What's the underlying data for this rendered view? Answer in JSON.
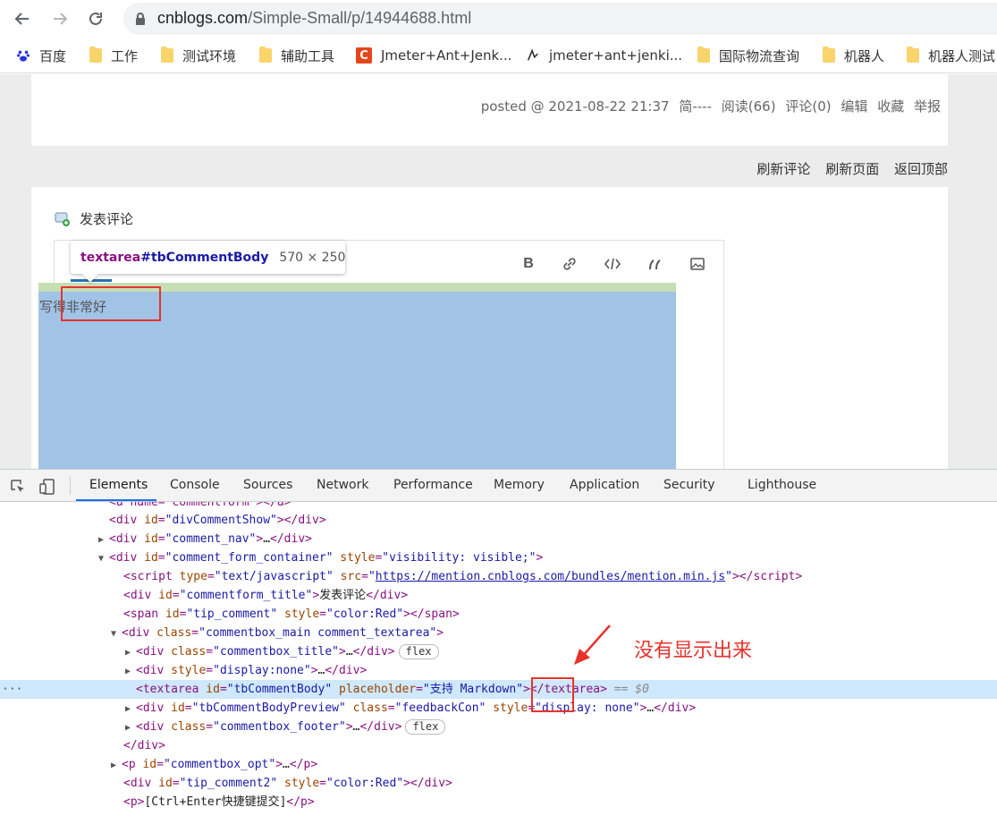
{
  "browser": {
    "url_prefix": "cnblogs.com",
    "url_path": "/Simple-Small/p/14944688.html",
    "bookmarks": [
      {
        "label": "百度",
        "icon": "baidu-paw-icon"
      },
      {
        "label": "工作",
        "icon": "folder-icon"
      },
      {
        "label": "测试环境",
        "icon": "folder-icon"
      },
      {
        "label": "辅助工具",
        "icon": "folder-icon"
      },
      {
        "label": "Jmeter+Ant+Jenk...",
        "icon": "csdn-icon"
      },
      {
        "label": "jmeter+ant+jenki...",
        "icon": "site-icon"
      },
      {
        "label": "国际物流查询",
        "icon": "folder-icon"
      },
      {
        "label": "机器人",
        "icon": "folder-icon"
      },
      {
        "label": "机器人测试",
        "icon": "folder-icon"
      }
    ]
  },
  "post": {
    "posted": "posted @ 2021-08-22 21:37",
    "author": "简----",
    "reads": "阅读(66)",
    "comments": "评论(0)",
    "edit": "编辑",
    "favorite": "收藏",
    "report": "举报"
  },
  "links": {
    "refresh_comments": "刷新评论",
    "refresh_page": "刷新页面",
    "back_to_top": "返回顶部"
  },
  "comment_form": {
    "title": "发表评论",
    "textarea_text": "写得非常好",
    "tooltip_tag": "textarea",
    "tooltip_id": "#tbCommentBody",
    "tooltip_size": "570 × 250",
    "toolbar_bold": "B"
  },
  "devtools": {
    "tabs": [
      "Elements",
      "Console",
      "Sources",
      "Network",
      "Performance",
      "Memory",
      "Application",
      "Security",
      "Lighthouse"
    ],
    "active_tab": "Elements",
    "lines": {
      "l0": "<a name=\"commentform\"></a>",
      "l1_tag": "div",
      "l1_attr": "id",
      "l1_val": "divCommentShow",
      "l2_val": "comment_nav",
      "l3_val": "comment_form_container",
      "l3_style": "visibility: visible;",
      "l4_type": "text/javascript",
      "l4_src": "https://mention.cnblogs.com/bundles/mention.min.js",
      "l5_val": "commentform_title",
      "l5_text": "发表评论",
      "l6_val": "tip_comment",
      "l6_style": "color:Red",
      "l7_val": "commentbox_main comment_textarea",
      "l8_val": "commentbox_title",
      "l8_pill": "flex",
      "l9_style": "display:none",
      "l10_id": "tbCommentBody",
      "l10_placeholder": "支持 Markdown",
      "l10_suffix": "== $0",
      "l11_id": "tbCommentBodyPreview",
      "l11_class": "feedbackCon",
      "l11_style": "display: none",
      "l12_val": "commentbox_footer",
      "l12_pill": "flex",
      "l14_val": "commentbox_opt",
      "l15_val": "tip_comment2",
      "l15_style": "color:Red",
      "l16_text": "[Ctrl+Enter快捷键提交]"
    }
  },
  "annotation": {
    "note": "没有显示出来"
  }
}
